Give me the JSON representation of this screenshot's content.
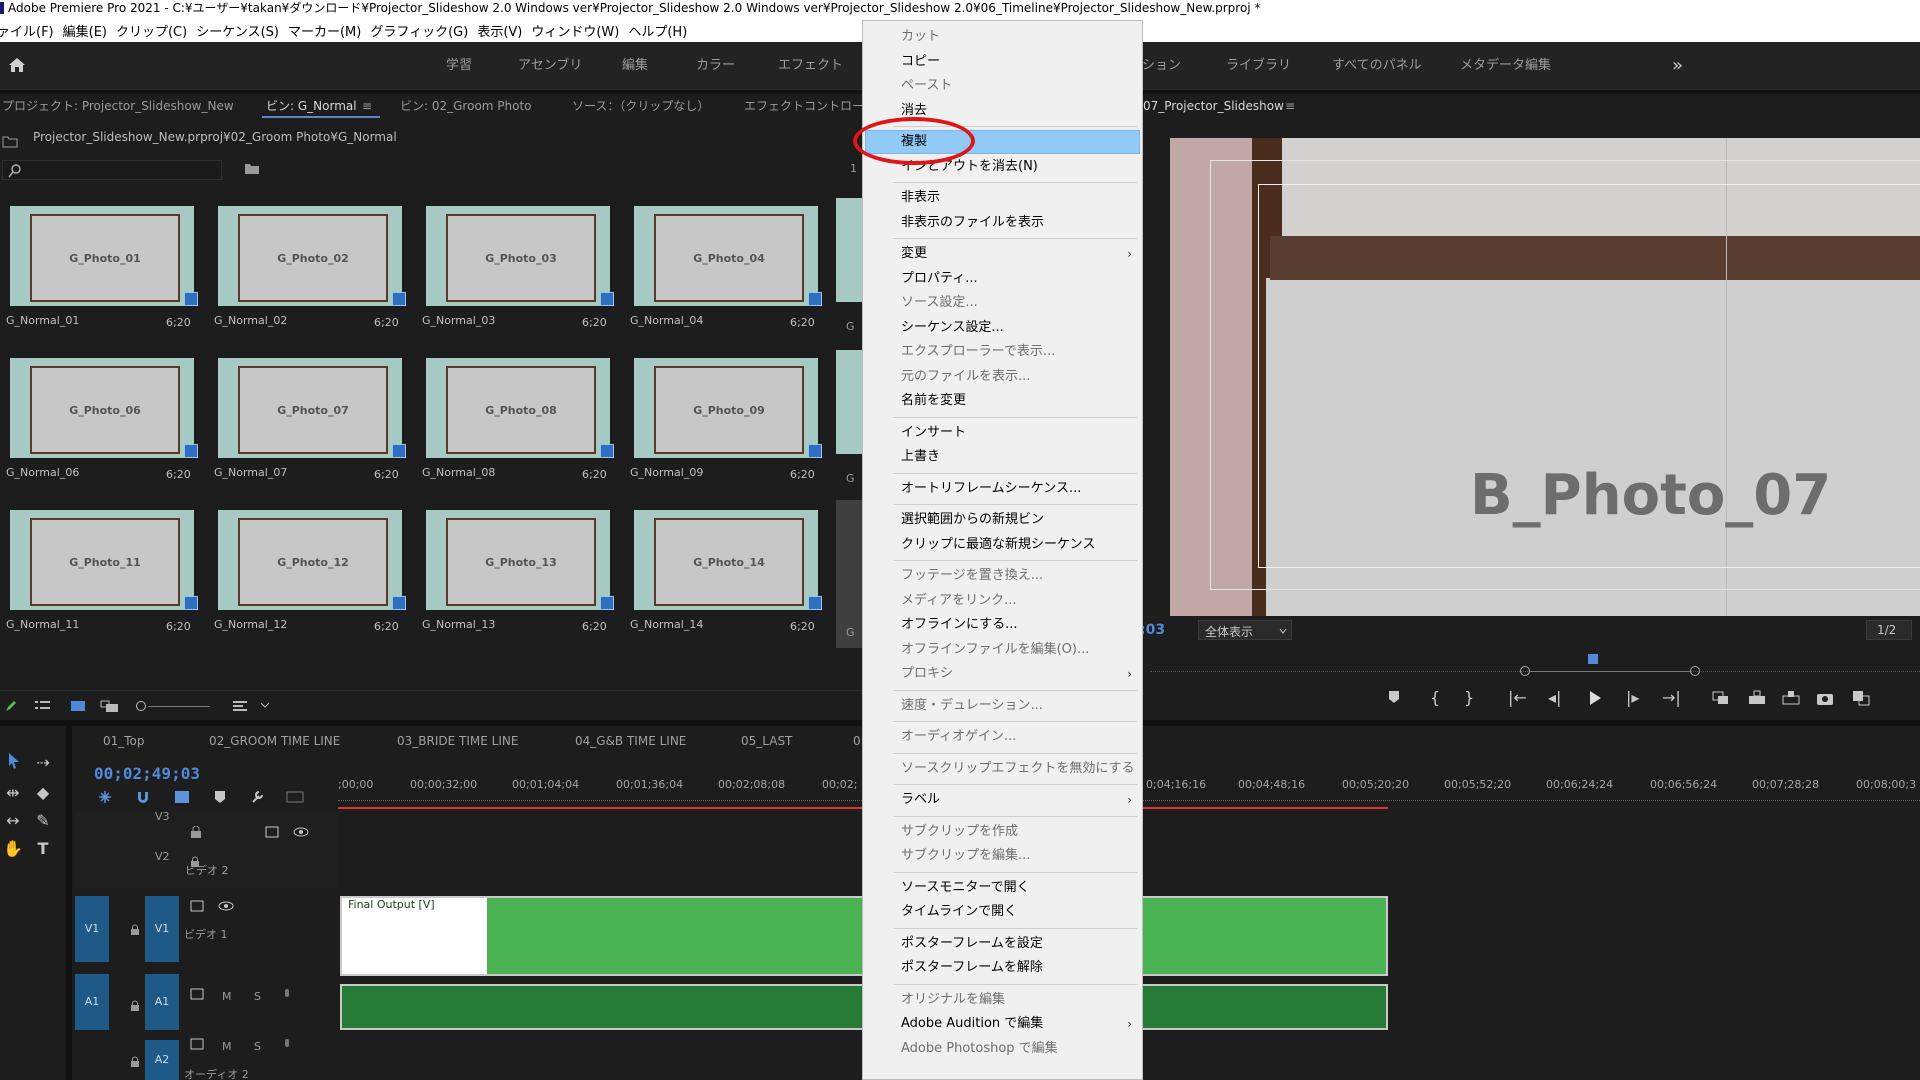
{
  "window": {
    "title": "Adobe Premiere Pro 2021 - C:¥ユーザー¥takan¥ダウンロード¥Projector_Slideshow 2.0 Windows ver¥Projector_Slideshow 2.0 Windows ver¥Projector_Slideshow 2.0¥06_Timeline¥Projector_Slideshow_New.prproj *"
  },
  "menu": [
    "ァイル(F)",
    "編集(E)",
    "クリップ(C)",
    "シーケンス(S)",
    "マーカー(M)",
    "グラフィック(G)",
    "表示(V)",
    "ウィンドウ(W)",
    "ヘルプ(H)"
  ],
  "workspaces": {
    "left": [
      "学習",
      "アセンブリ",
      "編集",
      "カラー",
      "エフェクト"
    ],
    "right": [
      "ション",
      "ライブラリ",
      "すべてのパネル",
      "メタデータ編集"
    ],
    "more": "»"
  },
  "project": {
    "tabs": [
      "プロジェクト: Projector_Slideshow_New",
      "ビン: G_Normal",
      "ビン: 02_Groom Photo",
      "ソース：（クリップなし）",
      "エフェクトコントロー"
    ],
    "tab_menu": "≡",
    "path": "Projector_Slideshow_New.prproj¥02_Groom Photo¥G_Normal",
    "count_partial": "1",
    "items": [
      {
        "photo": "G_Photo_01",
        "name": "G_Normal_01",
        "dur": "6;20"
      },
      {
        "photo": "G_Photo_02",
        "name": "G_Normal_02",
        "dur": "6;20"
      },
      {
        "photo": "G_Photo_03",
        "name": "G_Normal_03",
        "dur": "6;20"
      },
      {
        "photo": "G_Photo_04",
        "name": "G_Normal_04",
        "dur": "6;20"
      },
      {
        "photo": "G_Photo_06",
        "name": "G_Normal_06",
        "dur": "6;20"
      },
      {
        "photo": "G_Photo_07",
        "name": "G_Normal_07",
        "dur": "6;20"
      },
      {
        "photo": "G_Photo_08",
        "name": "G_Normal_08",
        "dur": "6;20"
      },
      {
        "photo": "G_Photo_09",
        "name": "G_Normal_09",
        "dur": "6;20"
      },
      {
        "photo": "G_Photo_11",
        "name": "G_Normal_11",
        "dur": "6;20"
      },
      {
        "photo": "G_Photo_12",
        "name": "G_Normal_12",
        "dur": "6;20"
      },
      {
        "photo": "G_Photo_13",
        "name": "G_Normal_13",
        "dur": "6;20"
      },
      {
        "photo": "G_Photo_14",
        "name": "G_Normal_14",
        "dur": "6;20"
      }
    ],
    "partial_labels": [
      "G",
      "G",
      "G"
    ]
  },
  "program": {
    "tab": "07_Projector_Slideshow",
    "tab_menu": "≡",
    "overlay_text": "B_Photo_07",
    "fit": "全体表示",
    "timecode_partial": ";03",
    "resolution": "1/2"
  },
  "timeline": {
    "tabs": [
      "01_Top",
      "02_GROOM TIME LINE",
      "03_BRIDE TIME LINE",
      "04_G&B TIME LINE",
      "05_LAST",
      "0"
    ],
    "timecode": "00;02;49;03",
    "ruler_left": [
      ";00;00",
      "00;00;32;00",
      "00;01;04;04",
      "00;01;36;04",
      "00;02;08;08",
      "00;02;"
    ],
    "ruler_right": [
      "0;04;16;16",
      "00;04;48;16",
      "00;05;20;20",
      "00;05;52;20",
      "00;06;24;24",
      "00;06;56;24",
      "00;07;28;28",
      "00;08;00;3"
    ],
    "tracks": {
      "v3": "V3",
      "v2": "V2",
      "v2_name": "ビデオ 2",
      "v1": "V1",
      "v1_name": "ビデオ 1",
      "a1": "A1",
      "a2": "A2",
      "a2_name": "オーディオ 2",
      "m": "M",
      "s": "S"
    },
    "clip_label": "Final Output [V]"
  },
  "context_menu": [
    {
      "label": "カット",
      "enabled": false
    },
    {
      "label": "コピー",
      "enabled": true
    },
    {
      "label": "ペースト",
      "enabled": false
    },
    {
      "label": "消去",
      "enabled": true
    },
    {
      "label": "複製",
      "enabled": true,
      "highlight": true
    },
    {
      "label": "インとアウトを消去(N)",
      "enabled": true
    },
    {
      "label": "非表示",
      "enabled": true
    },
    {
      "label": "非表示のファイルを表示",
      "enabled": true
    },
    {
      "label": "変更",
      "enabled": true,
      "sub": true
    },
    {
      "label": "プロパティ...",
      "enabled": true
    },
    {
      "label": "ソース設定...",
      "enabled": false
    },
    {
      "label": "シーケンス設定...",
      "enabled": true
    },
    {
      "label": "エクスプローラーで表示...",
      "enabled": false
    },
    {
      "label": "元のファイルを表示...",
      "enabled": false
    },
    {
      "label": "名前を変更",
      "enabled": true
    },
    {
      "label": "インサート",
      "enabled": true
    },
    {
      "label": "上書き",
      "enabled": true
    },
    {
      "label": "オートリフレームシーケンス...",
      "enabled": true
    },
    {
      "label": "選択範囲からの新規ビン",
      "enabled": true
    },
    {
      "label": "クリップに最適な新規シーケンス",
      "enabled": true
    },
    {
      "label": "フッテージを置き換え...",
      "enabled": false
    },
    {
      "label": "メディアをリンク...",
      "enabled": false
    },
    {
      "label": "オフラインにする...",
      "enabled": true
    },
    {
      "label": "オフラインファイルを編集(O)...",
      "enabled": false
    },
    {
      "label": "プロキシ",
      "enabled": false,
      "sub": true
    },
    {
      "label": "速度・デュレーション...",
      "enabled": false
    },
    {
      "label": "オーディオゲイン...",
      "enabled": false
    },
    {
      "label": "ソースクリップエフェクトを無効にする",
      "enabled": false
    },
    {
      "label": "ラベル",
      "enabled": true,
      "sub": true
    },
    {
      "label": "サブクリップを作成",
      "enabled": false
    },
    {
      "label": "サブクリップを編集...",
      "enabled": false
    },
    {
      "label": "ソースモニターで開く",
      "enabled": true
    },
    {
      "label": "タイムラインで開く",
      "enabled": true
    },
    {
      "label": "ポスターフレームを設定",
      "enabled": true
    },
    {
      "label": "ポスターフレームを解除",
      "enabled": true
    },
    {
      "label": "オリジナルを編集",
      "enabled": false
    },
    {
      "label": "Adobe Audition で編集",
      "enabled": true,
      "sub": true
    },
    {
      "label": "Adobe Photoshop で編集",
      "enabled": false
    }
  ],
  "colors": {
    "accent": "#5d87c7",
    "highlight": "#91c9f7",
    "annotation": "#e0151a",
    "clip_video": "#4ab455",
    "clip_audio": "#257a36",
    "track_button": "#1f5987"
  }
}
